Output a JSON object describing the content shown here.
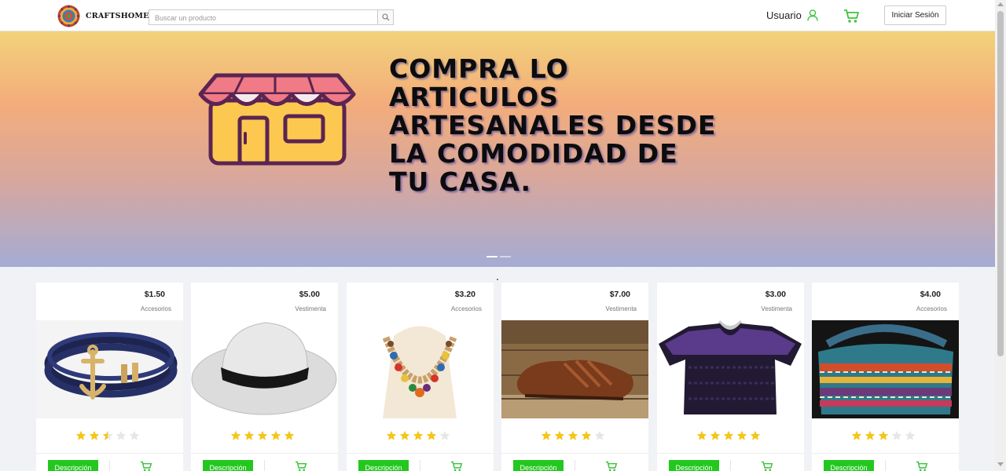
{
  "header": {
    "brand": "CRAFTSHOME",
    "search_placeholder": "Buscar un producto",
    "user_label": "Usuario",
    "login_label": "Iniciar Sesión"
  },
  "banner": {
    "lines": [
      "COMPRA LO",
      "ARTICULOS",
      "ARTESANALES DESDE",
      "LA COMODIDAD DE",
      "TU CASA."
    ],
    "slides": 2,
    "active_slide": 1
  },
  "colors": {
    "accent_green": "#23c81e",
    "star_gold": "#f5c518",
    "star_empty": "#e6e6e6"
  },
  "products": [
    {
      "price": "$1.50",
      "category": "Accesorios",
      "rating": 2.5,
      "image": "bracelet-image",
      "desc_label": "Descripción"
    },
    {
      "price": "$5.00",
      "category": "Vestimenta",
      "rating": 5,
      "image": "hat-image",
      "desc_label": "Descripción"
    },
    {
      "price": "$3.20",
      "category": "Accesorios",
      "rating": 4,
      "image": "necklace-image",
      "desc_label": "Descripción"
    },
    {
      "price": "$7.00",
      "category": "Vestimenta",
      "rating": 4,
      "image": "shoe-image",
      "desc_label": "Descripción"
    },
    {
      "price": "$3.00",
      "category": "Vestimenta",
      "rating": 5,
      "image": "blouse-image",
      "desc_label": "Descripción"
    },
    {
      "price": "$4.00",
      "category": "Accesorios",
      "rating": 3,
      "image": "bag-image",
      "desc_label": "Descripción"
    }
  ]
}
